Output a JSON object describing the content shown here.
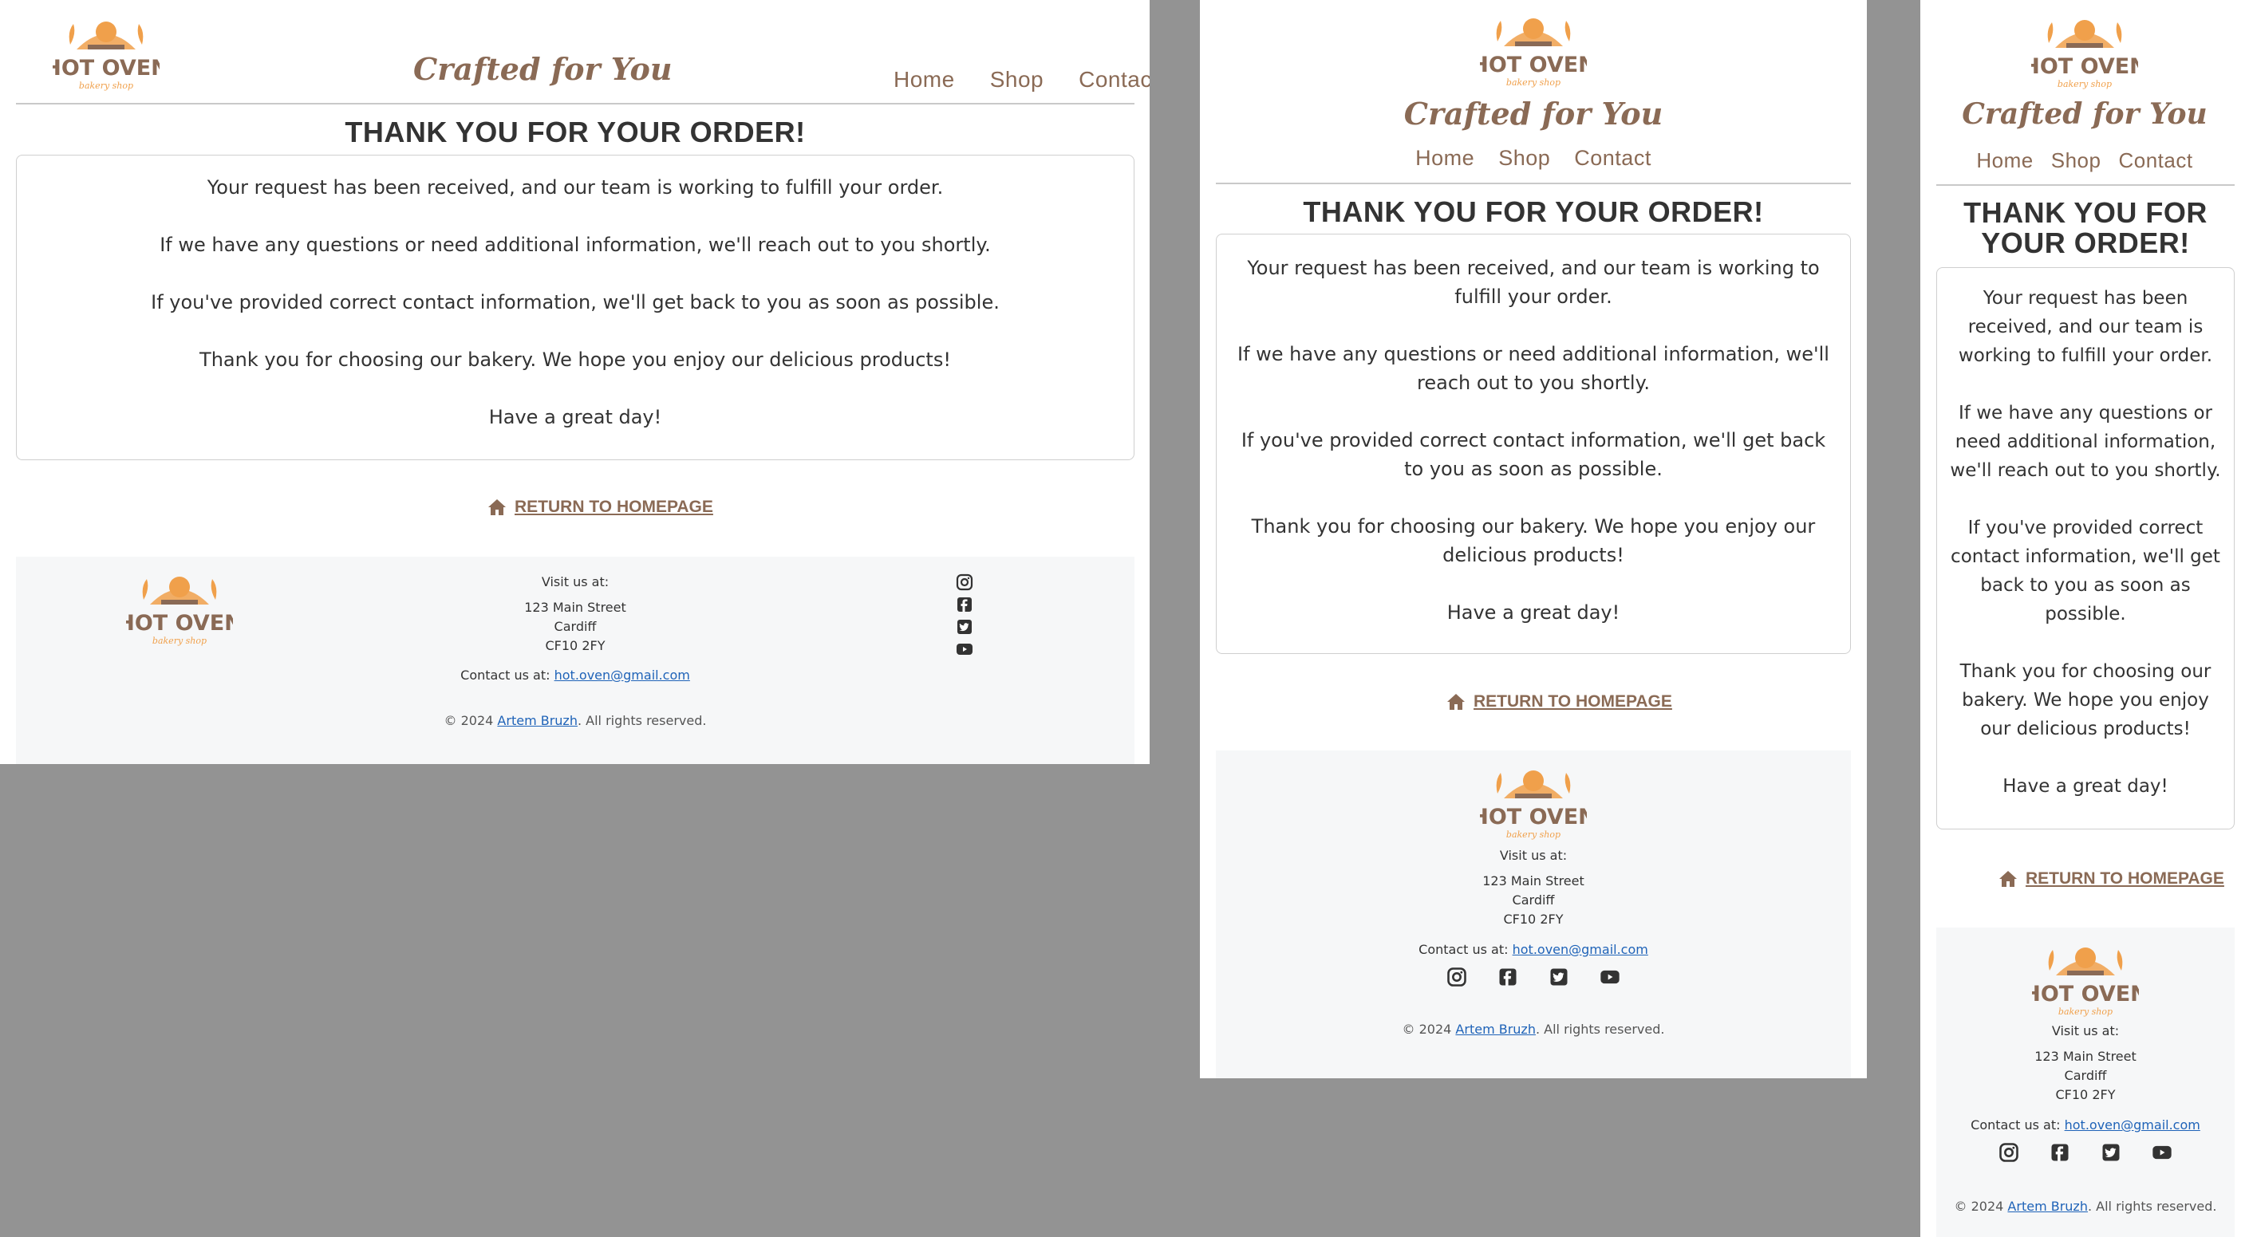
{
  "brand": {
    "name": "HOT OVEN",
    "subtitle": "bakery shop",
    "tagline": "Crafted for You"
  },
  "nav": {
    "home": "Home",
    "shop": "Shop",
    "contact": "Contact"
  },
  "confirmation": {
    "title": "THANK YOU FOR YOUR ORDER!",
    "p1": "Your request has been received, and our team is working to fulfill your order.",
    "p2": "If we have any questions or need additional information, we'll reach out to you shortly.",
    "p3": "If you've provided correct contact information, we'll get back to you as soon as possible.",
    "p4": "Thank you for choosing our bakery. We hope you enjoy our delicious products!",
    "p5": "Have a great day!"
  },
  "return_link": "RETURN TO HOMEPAGE",
  "footer": {
    "visit_label": "Visit us at:",
    "address_line1": "123 Main Street",
    "address_line2": "Cardiff",
    "address_line3": "CF10 2FY",
    "contact_label": "Contact us at:",
    "email": "hot.oven@gmail.com",
    "copyright_prefix": "© 2024",
    "author": "Artem Bruzh",
    "copyright_suffix": ". All rights reserved.",
    "social": [
      "instagram-icon",
      "facebook-icon",
      "twitter-icon",
      "youtube-icon"
    ]
  },
  "colors": {
    "brand_brown": "#8a6a55",
    "logo_orange": "#f0a04b",
    "footer_bg": "#f6f7f8",
    "link_blue": "#1f63b8",
    "backdrop": "#939393"
  }
}
